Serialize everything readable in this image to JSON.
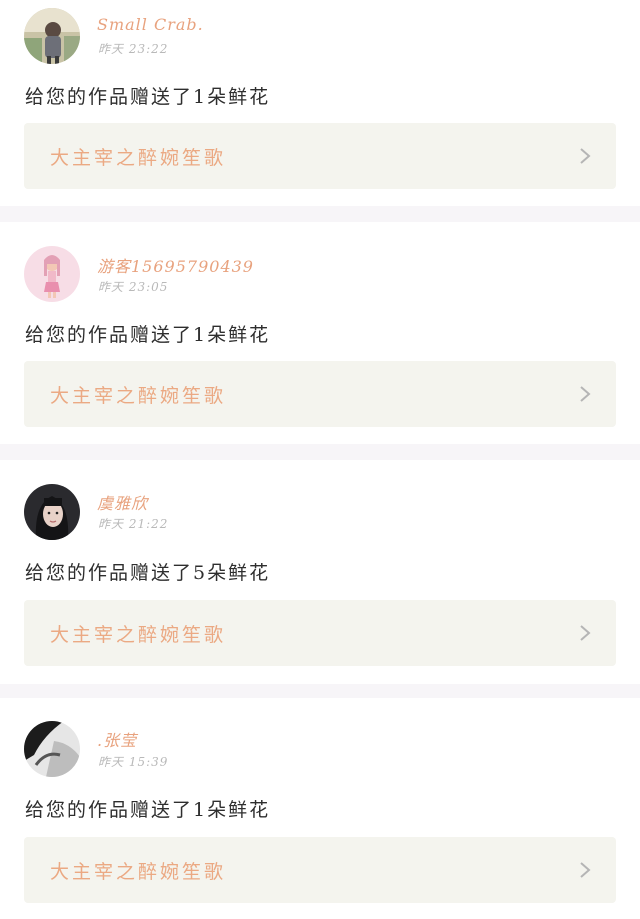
{
  "notifications": [
    {
      "username": "Small Crab.",
      "timestamp": "昨天 23:22",
      "message": "给您的作品赠送了1朵鲜花",
      "work_title": "大主宰之醉婉笙歌",
      "avatar_icon": "avatar-girl-outdoor"
    },
    {
      "username": "游客15695790439",
      "timestamp": "昨天 23:05",
      "message": "给您的作品赠送了1朵鲜花",
      "work_title": "大主宰之醉婉笙歌",
      "avatar_icon": "avatar-cartoon-girl"
    },
    {
      "username": "虞雅欣",
      "timestamp": "昨天 21:22",
      "message": "给您的作品赠送了5朵鲜花",
      "work_title": "大主宰之醉婉笙歌",
      "avatar_icon": "avatar-dark-hair-girl"
    },
    {
      "username": ".张莹",
      "timestamp": "昨天 15:39",
      "message": "给您的作品赠送了1朵鲜花",
      "work_title": "大主宰之醉婉笙歌",
      "avatar_icon": "avatar-monochrome"
    }
  ],
  "colors": {
    "username": "#e8a27e",
    "work_title": "#eba983",
    "card_bg": "#f4f4ee",
    "separator": "#f7f5f8"
  }
}
